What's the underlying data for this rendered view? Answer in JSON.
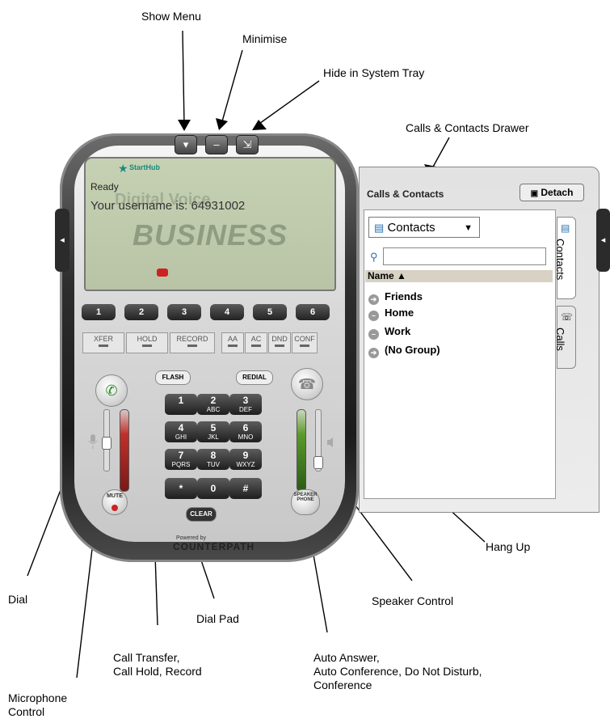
{
  "callouts": {
    "show_menu": "Show Menu",
    "minimise": "Minimise",
    "hide_tray": "Hide in System Tray",
    "drawer": "Calls & Contacts Drawer",
    "hang_up": "Hang Up",
    "speaker": "Speaker Control",
    "dial": "Dial",
    "dial_pad": "Dial Pad",
    "xfer_1": "Call Transfer,",
    "xfer_2": "Call Hold, Record",
    "auto_1": "Auto Answer,",
    "auto_2": "Auto Conference, Do Not Disturb,",
    "auto_3": "Conference",
    "mic_1": "Microphone",
    "mic_2": "Control"
  },
  "phone": {
    "top_buttons": [
      "▾",
      "–",
      "⇲"
    ],
    "side_tab_icon": "◂",
    "brand": "StartHub",
    "status": "Ready",
    "bg_text_1": "Digital Voice",
    "username": "Your username is: 64931002",
    "bg_text_2": "BUSINESS",
    "lines": [
      "1",
      "2",
      "3",
      "4",
      "5",
      "6"
    ],
    "fkeys": [
      "XFER",
      "HOLD",
      "RECORD",
      "AA",
      "AC",
      "DND",
      "CONF"
    ],
    "flash": "FLASH",
    "redial": "REDIAL",
    "dial_icon": "✆",
    "hangup_icon": "☎",
    "keypad": [
      {
        "d": "1",
        "l": ""
      },
      {
        "d": "2",
        "l": "ABC"
      },
      {
        "d": "3",
        "l": "DEF"
      },
      {
        "d": "4",
        "l": "GHI"
      },
      {
        "d": "5",
        "l": "JKL"
      },
      {
        "d": "6",
        "l": "MNO"
      },
      {
        "d": "7",
        "l": "PQRS"
      },
      {
        "d": "8",
        "l": "TUV"
      },
      {
        "d": "9",
        "l": "WXYZ"
      },
      {
        "d": "*",
        "l": ""
      },
      {
        "d": "0",
        "l": ""
      },
      {
        "d": "#",
        "l": ""
      }
    ],
    "clear": "CLEAR",
    "mute": "MUTE",
    "speaker_label": "SPEAKER PHONE",
    "powered_by": "Powered by",
    "counterpath": "COUNTERPATH"
  },
  "drawer": {
    "title": "Calls & Contacts",
    "detach": "Detach",
    "contacts_select": "Contacts",
    "column_name": "Name ▲",
    "groups": [
      "Friends",
      "Home",
      "Work",
      "(No Group)"
    ],
    "tab_contacts": "Contacts",
    "tab_calls": "Calls"
  },
  "colors": {
    "screen": "#c6d1b4",
    "brand_accent": "#1a8a7a",
    "dial_green": "#2a8a2a",
    "meter_red": "#c0302a",
    "meter_green": "#5c9a2a",
    "header_bar": "#d8d2c4"
  },
  "icons": {
    "search": "magnifier-icon",
    "clear": "close-x-icon",
    "dial": "phone-handset-icon",
    "hang_up": "phone-hangup-icon",
    "mic": "microphone-icon",
    "speaker": "speaker-icon"
  }
}
